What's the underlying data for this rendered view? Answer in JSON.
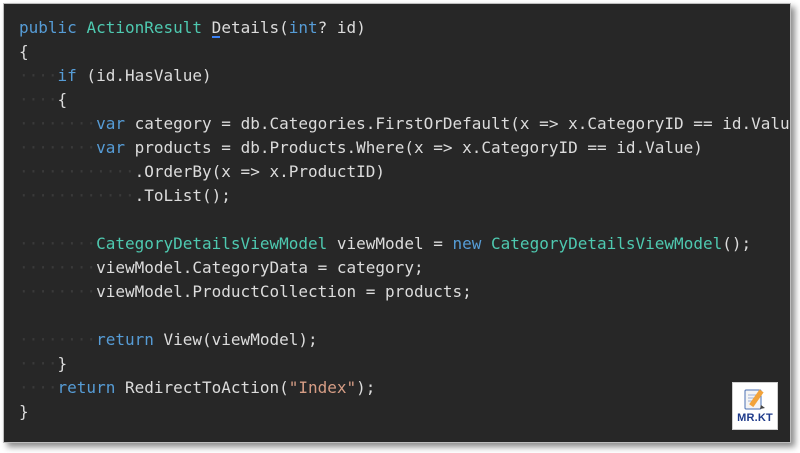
{
  "code": {
    "lines": [
      [
        {
          "t": "public ",
          "c": "kw"
        },
        {
          "t": "ActionResult",
          "c": "ty"
        },
        {
          "t": " ",
          "c": "tx"
        },
        {
          "t": "D",
          "c": "tx",
          "caret": true
        },
        {
          "t": "etails(",
          "c": "tx"
        },
        {
          "t": "int",
          "c": "kw"
        },
        {
          "t": "? id)",
          "c": "tx"
        }
      ],
      [
        {
          "t": "{",
          "c": "tx"
        }
      ],
      [
        {
          "t": "····",
          "c": "dots"
        },
        {
          "t": "if",
          "c": "kw"
        },
        {
          "t": " (id.HasValue)",
          "c": "tx"
        }
      ],
      [
        {
          "t": "····",
          "c": "dots"
        },
        {
          "t": "{",
          "c": "tx"
        }
      ],
      [
        {
          "t": "········",
          "c": "dots"
        },
        {
          "t": "var",
          "c": "kw"
        },
        {
          "t": " category = db.Categories.FirstOrDefault(x => x.CategoryID == id.Value);",
          "c": "tx"
        }
      ],
      [
        {
          "t": "········",
          "c": "dots"
        },
        {
          "t": "var",
          "c": "kw"
        },
        {
          "t": " products = db.Products.Where(x => x.CategoryID == id.Value)",
          "c": "tx"
        }
      ],
      [
        {
          "t": "············",
          "c": "dots"
        },
        {
          "t": ".OrderBy(x => x.ProductID)",
          "c": "tx"
        }
      ],
      [
        {
          "t": "············",
          "c": "dots"
        },
        {
          "t": ".ToList();",
          "c": "tx"
        }
      ],
      [],
      [
        {
          "t": "········",
          "c": "dots"
        },
        {
          "t": "CategoryDetailsViewModel",
          "c": "ty"
        },
        {
          "t": " viewModel = ",
          "c": "tx"
        },
        {
          "t": "new",
          "c": "kw"
        },
        {
          "t": " ",
          "c": "tx"
        },
        {
          "t": "CategoryDetailsViewModel",
          "c": "ty"
        },
        {
          "t": "();",
          "c": "tx"
        }
      ],
      [
        {
          "t": "········",
          "c": "dots"
        },
        {
          "t": "viewModel.CategoryData = category;",
          "c": "tx"
        }
      ],
      [
        {
          "t": "········",
          "c": "dots"
        },
        {
          "t": "viewModel.ProductCollection = products;",
          "c": "tx"
        }
      ],
      [],
      [
        {
          "t": "········",
          "c": "dots"
        },
        {
          "t": "return",
          "c": "kw"
        },
        {
          "t": " View(viewModel);",
          "c": "tx"
        }
      ],
      [
        {
          "t": "····",
          "c": "dots"
        },
        {
          "t": "}",
          "c": "tx"
        }
      ],
      [
        {
          "t": "····",
          "c": "dots"
        },
        {
          "t": "return",
          "c": "kw"
        },
        {
          "t": " RedirectToAction(",
          "c": "tx"
        },
        {
          "t": "\"Index\"",
          "c": "str"
        },
        {
          "t": ");",
          "c": "tx"
        }
      ],
      [
        {
          "t": "}",
          "c": "tx"
        }
      ]
    ]
  },
  "colors": {
    "background": "#272727",
    "keyword": "#569cd6",
    "type": "#4ec9b0",
    "string": "#d69d85",
    "text": "#dcdcdc"
  },
  "logo": {
    "text": "MR.KT",
    "icon": "notebook-pencil-icon"
  }
}
